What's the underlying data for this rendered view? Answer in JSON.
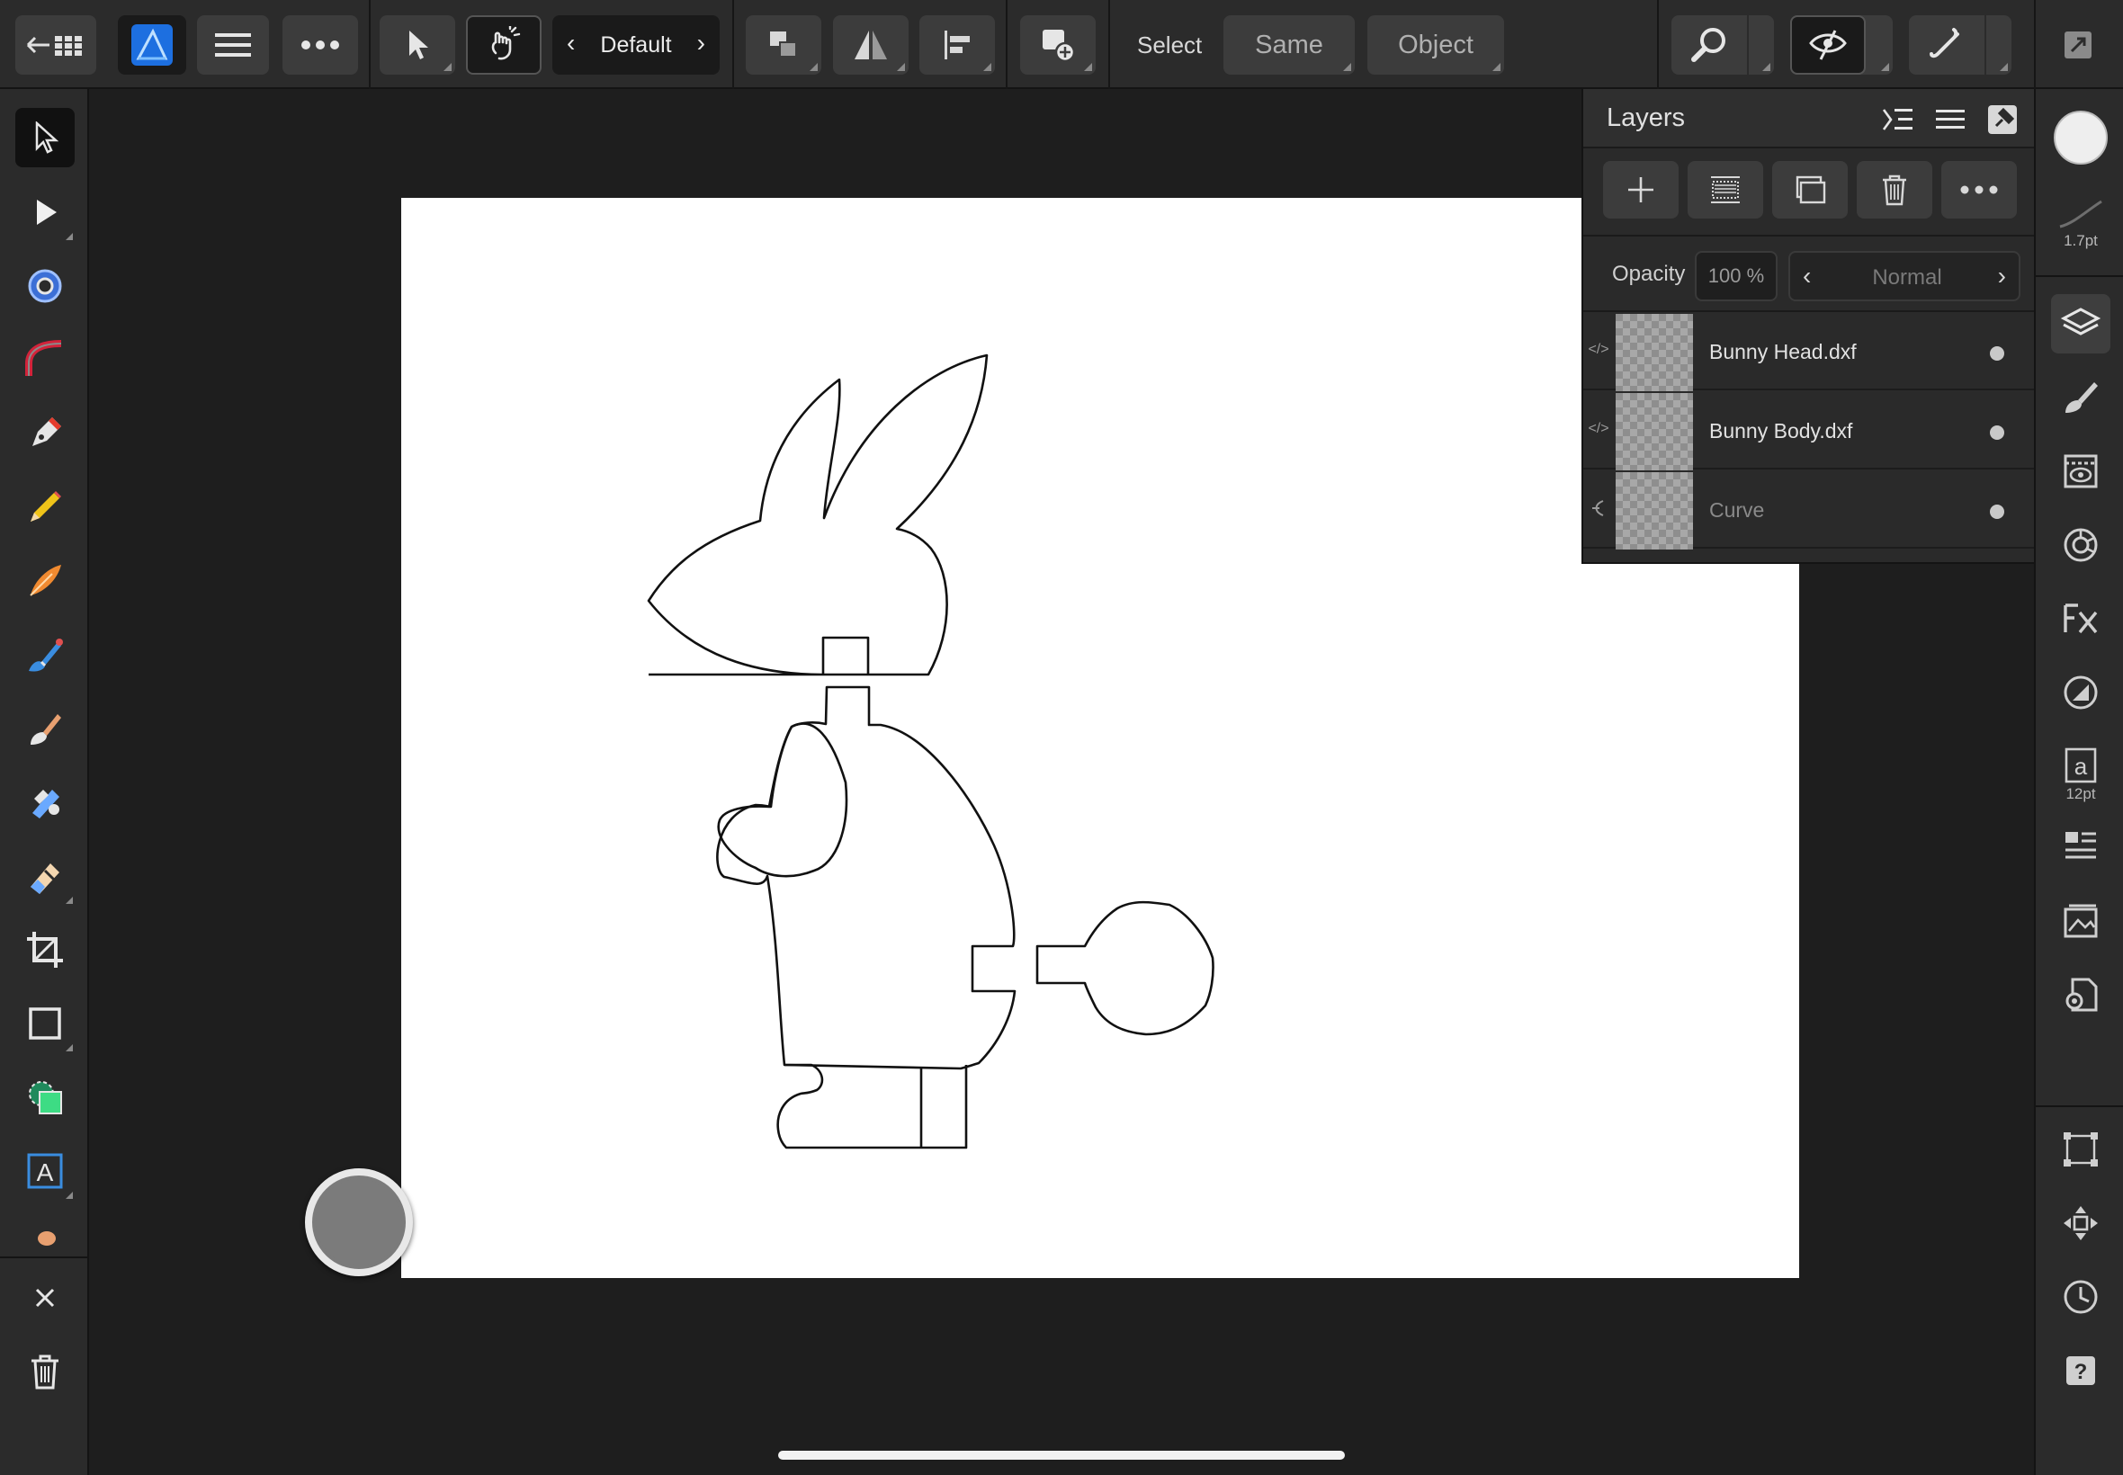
{
  "topbar": {
    "back_icon": "back-arrow-grid-icon",
    "app_icon": "affinity-designer-logo",
    "menu_icon": "hamburger-icon",
    "more_icon": "ellipsis-icon",
    "move_tool_icon": "pointer-icon",
    "gesture_icon": "touch-hand-icon",
    "preset_label": "Default",
    "arrange_icon": "arrange-icon",
    "flip_icon": "flip-icon",
    "align_icon": "align-left-icon",
    "insert_icon": "insert-target-icon",
    "select_label": "Select",
    "same_label": "Same",
    "object_label": "Object",
    "zoom_icon": "magnifier-icon",
    "view_icon": "view-mode-icon",
    "snap_icon": "snapping-magnet-icon",
    "fullscreen_icon": "fullscreen-icon"
  },
  "left_tools": [
    "move-tool-icon",
    "node-tool-icon",
    "point-transform-tool-icon",
    "corner-tool-icon",
    "pen-tool-icon",
    "pencil-tool-icon",
    "vector-brush-tool-icon",
    "fill-tool-icon",
    "paint-brush-tool-icon",
    "pixel-tool-icon",
    "erase-tool-icon",
    "crop-tool-icon",
    "rectangle-tool-icon",
    "shape-builder-tool-icon",
    "artistic-text-tool-icon"
  ],
  "left_bottom": {
    "close_icon": "close-icon",
    "delete_icon": "trash-icon"
  },
  "right_studio": {
    "fill_color": "#eeeeee",
    "stroke_caption": "1.7pt",
    "text_caption": "12pt"
  },
  "layers_panel": {
    "title": "Layers",
    "opacity_label": "Opacity",
    "opacity_value": "100 %",
    "blend_mode": "Normal",
    "layers": [
      {
        "name": "Bunny Head.dxf",
        "dim": false
      },
      {
        "name": "Bunny Body.dxf",
        "dim": false
      },
      {
        "name": "Curve",
        "dim": true
      }
    ]
  },
  "colors": {
    "ui_dark": "#2b2b2b",
    "button": "#3c3c3c",
    "accent_blue": "#2e8bff",
    "canvas": "#ffffff"
  }
}
